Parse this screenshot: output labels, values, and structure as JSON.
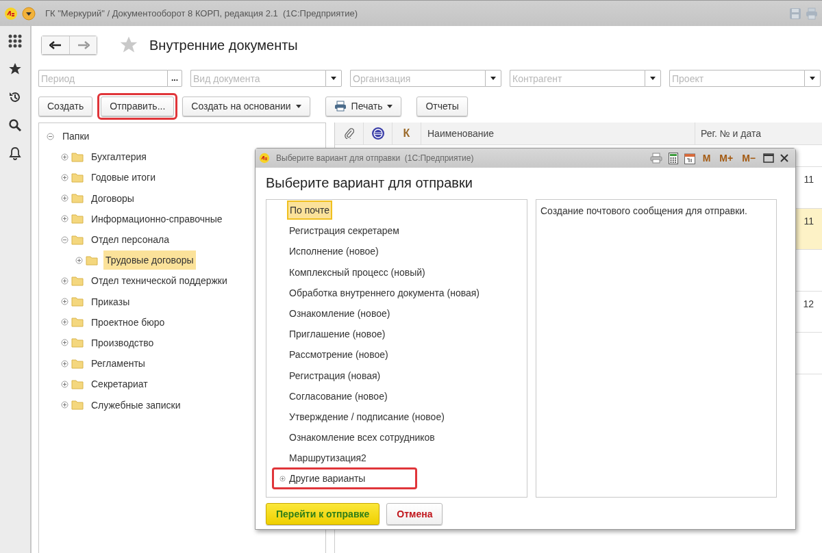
{
  "window": {
    "title": "ГК \"Меркурий\" / Документооборот 8 КОРП, редакция 2.1  (1С:Предприятие)"
  },
  "page": {
    "title": "Внутренние документы"
  },
  "filters": [
    {
      "placeholder": "Период",
      "kind": "period",
      "button_label": "..."
    },
    {
      "placeholder": "Вид документа",
      "kind": "select"
    },
    {
      "placeholder": "Организация",
      "kind": "select"
    },
    {
      "placeholder": "Контрагент",
      "kind": "select"
    },
    {
      "placeholder": "Проект",
      "kind": "select"
    }
  ],
  "toolbar": [
    {
      "label": "Создать",
      "kind": "button",
      "highlighted": false
    },
    {
      "label": "Отправить...",
      "kind": "button",
      "highlighted": true
    },
    {
      "label": "Создать на основании",
      "kind": "dropdown",
      "highlighted": false
    },
    {
      "label": "Печать",
      "kind": "print",
      "highlighted": false
    },
    {
      "label": "Отчеты",
      "kind": "button",
      "highlighted": false
    }
  ],
  "folders": {
    "label": "Папки",
    "expanded": true,
    "selected": false,
    "children": [
      {
        "label": "Бухгалтерия",
        "expanded": false,
        "selected": false
      },
      {
        "label": "Годовые итоги",
        "expanded": false,
        "selected": false
      },
      {
        "label": "Договоры",
        "expanded": false,
        "selected": false
      },
      {
        "label": "Информационно-справочные",
        "expanded": false,
        "selected": false
      },
      {
        "label": "Отдел персонала",
        "expanded": true,
        "selected": false,
        "children": [
          {
            "label": "Трудовые договоры",
            "expanded": false,
            "selected": true
          }
        ]
      },
      {
        "label": "Отдел технической поддержки",
        "expanded": false,
        "selected": false
      },
      {
        "label": "Приказы",
        "expanded": false,
        "selected": false
      },
      {
        "label": "Проектное бюро",
        "expanded": false,
        "selected": false
      },
      {
        "label": "Производство",
        "expanded": false,
        "selected": false
      },
      {
        "label": "Регламенты",
        "expanded": false,
        "selected": false
      },
      {
        "label": "Секретариат",
        "expanded": false,
        "selected": false
      },
      {
        "label": "Служебные записки",
        "expanded": false,
        "selected": false
      }
    ]
  },
  "table": {
    "columns": [
      {
        "kind": "attachment"
      },
      {
        "kind": "seal"
      },
      {
        "kind": "text",
        "label": "К"
      },
      {
        "kind": "text",
        "label": "Наименование"
      },
      {
        "kind": "text",
        "label": "Рег. № и дата"
      }
    ],
    "rows": [
      {
        "reg": "11",
        "selected": false
      },
      {
        "reg": "11",
        "selected": true
      },
      {
        "selected": false
      },
      {
        "reg": "12",
        "selected": false
      },
      {
        "selected": false
      }
    ]
  },
  "dialog": {
    "title": "Выберите вариант для отправки  (1С:Предприятие)",
    "heading": "Выберите вариант для отправки",
    "memory_buttons": [
      "M",
      "M+",
      "M−"
    ],
    "options": [
      {
        "label": "По почте",
        "kind": "item",
        "selected": true,
        "highlighted": false
      },
      {
        "label": "Регистрация секретарем",
        "kind": "item",
        "selected": false,
        "highlighted": false
      },
      {
        "label": "Исполнение (новое)",
        "kind": "item",
        "selected": false,
        "highlighted": false
      },
      {
        "label": "Комплексный процесс (новый)",
        "kind": "item",
        "selected": false,
        "highlighted": false
      },
      {
        "label": "Обработка внутреннего документа (новая)",
        "kind": "item",
        "selected": false,
        "highlighted": false
      },
      {
        "label": "Ознакомление (новое)",
        "kind": "item",
        "selected": false,
        "highlighted": false
      },
      {
        "label": "Приглашение (новое)",
        "kind": "item",
        "selected": false,
        "highlighted": false
      },
      {
        "label": "Рассмотрение (новое)",
        "kind": "item",
        "selected": false,
        "highlighted": false
      },
      {
        "label": "Регистрация (новая)",
        "kind": "item",
        "selected": false,
        "highlighted": false
      },
      {
        "label": "Согласование (новое)",
        "kind": "item",
        "selected": false,
        "highlighted": false
      },
      {
        "label": "Утверждение / подписание (новое)",
        "kind": "item",
        "selected": false,
        "highlighted": false
      },
      {
        "label": "Ознакомление всех сотрудников",
        "kind": "item",
        "selected": false,
        "highlighted": false
      },
      {
        "label": "Маршрутизация2",
        "kind": "item",
        "selected": false,
        "highlighted": false
      },
      {
        "label": "Другие варианты",
        "kind": "group",
        "selected": false,
        "highlighted": true
      }
    ],
    "description": "Создание почтового сообщения для отправки.",
    "buttons": [
      {
        "label": "Перейти к отправке",
        "kind": "primary"
      },
      {
        "label": "Отмена",
        "kind": "cancel"
      }
    ]
  }
}
